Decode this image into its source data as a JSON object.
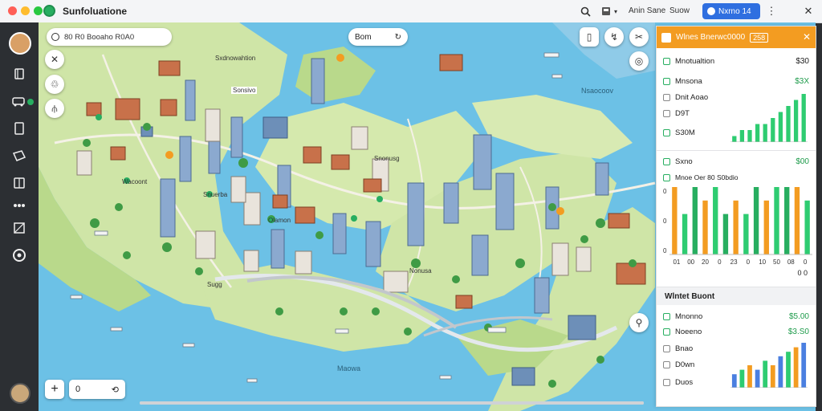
{
  "titlebar": {
    "app_title": "Sunfoluatione",
    "menu_a": "Anin Sane",
    "menu_b": "Suow",
    "user_label": "Nxrno 14",
    "icons": [
      "search-icon",
      "layers-icon",
      "menu-icon",
      "close-icon"
    ]
  },
  "sidebar": {
    "items": [
      "book-icon",
      "bus-icon",
      "document-icon",
      "ticket-icon",
      "book-open-icon",
      "grid-icon",
      "puzzle-icon",
      "compass-icon"
    ]
  },
  "map": {
    "search_text": "80 R0 Booaho R0A0",
    "view_label": "Bom",
    "zoom_value": "0",
    "place_labels": [
      "Sxdnowahtion",
      "Sonsivo",
      "Wacoont",
      "Snonusg",
      "Snuerba",
      "Olamon",
      "Nsaocoov",
      "Maowa",
      "Nonusa",
      "Sugg"
    ]
  },
  "panel": {
    "header_title": "Wlnes Bnerwc0000",
    "header_date": "258",
    "rows_a": [
      {
        "label": "Mnotualtion",
        "value": "$30"
      },
      {
        "label": "Mnsona",
        "value": "$3X"
      },
      {
        "label": "Dnit Aoao",
        "value": ""
      },
      {
        "label": "D9T",
        "value": ""
      },
      {
        "label": "S30M",
        "value": ""
      }
    ],
    "section_b": {
      "label": "Sxno",
      "value": "$00"
    },
    "section_b_sub": "Mnoe Oer 80 S0bdio",
    "chart_b_footer": "0 0",
    "section_c_title": "Wlntet Buont",
    "rows_c": [
      {
        "label": "Mnonno",
        "value": "$5.00"
      },
      {
        "label": "Noeeno",
        "value": "$3.S0"
      },
      {
        "label": "Bnao",
        "value": ""
      },
      {
        "label": "D0wn",
        "value": ""
      },
      {
        "label": "Duos",
        "value": ""
      }
    ]
  },
  "chart_data": [
    {
      "type": "bar",
      "title": "Mnotualtion",
      "series": [
        {
          "values": [
            1,
            2,
            2,
            3,
            3,
            4,
            5,
            6,
            7,
            8
          ]
        }
      ],
      "colors": [
        "#2ecc71"
      ]
    },
    {
      "type": "bar",
      "title": "Sxno",
      "x_tick_labels": [
        "01",
        "00",
        "20",
        "0",
        "23",
        "0",
        "10",
        "50",
        "08",
        "0"
      ],
      "y_tick_labels": [
        "0",
        "0",
        "0"
      ],
      "series": [
        {
          "values": [
            5,
            3,
            5,
            4,
            5,
            3,
            4,
            3,
            5,
            4,
            5,
            5,
            5,
            4
          ]
        }
      ],
      "colors": [
        "#f39c21",
        "#2ecc71",
        "#27ae60"
      ]
    },
    {
      "type": "bar",
      "title": "Wlntet Buont",
      "series": [
        {
          "values": [
            3,
            4,
            5,
            4,
            6,
            5,
            7,
            8,
            9,
            10
          ]
        }
      ],
      "colors": [
        "#4a7fe0",
        "#2ecc71",
        "#f39c21"
      ]
    }
  ]
}
